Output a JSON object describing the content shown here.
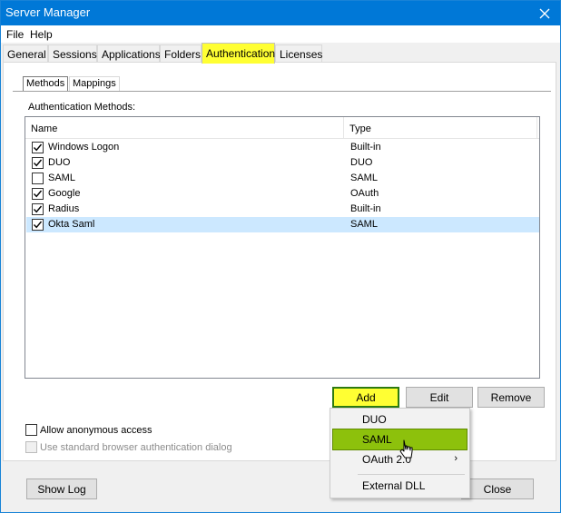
{
  "window": {
    "title": "Server Manager"
  },
  "menu": {
    "file": "File",
    "help": "Help"
  },
  "tabs": [
    "General",
    "Sessions",
    "Applications",
    "Folders",
    "Authentication",
    "Licenses"
  ],
  "active_tab": "Authentication",
  "subtabs": [
    "Methods",
    "Mappings"
  ],
  "active_subtab": "Methods",
  "auth_methods": {
    "caption": "Authentication Methods:",
    "columns": {
      "name": "Name",
      "type": "Type"
    },
    "rows": [
      {
        "name": "Windows Logon",
        "type": "Built-in",
        "checked": true
      },
      {
        "name": "DUO",
        "type": "DUO",
        "checked": true
      },
      {
        "name": "SAML",
        "type": "SAML",
        "checked": false
      },
      {
        "name": "Google",
        "type": "OAuth",
        "checked": true
      },
      {
        "name": "Radius",
        "type": "Built-in",
        "checked": true
      },
      {
        "name": "Okta Saml",
        "type": "SAML",
        "checked": true,
        "selected": true
      }
    ]
  },
  "buttons": {
    "add": "Add",
    "edit": "Edit",
    "remove": "Remove",
    "show_log": "Show Log",
    "close": "Close"
  },
  "options": {
    "anonymous": "Allow anonymous access",
    "browser_dialog": "Use standard browser authentication dialog"
  },
  "add_menu": {
    "items": [
      {
        "label": "DUO",
        "submenu": false
      },
      {
        "label": "SAML",
        "submenu": false,
        "hot": true
      },
      {
        "label": "OAuth 2.0",
        "submenu": true
      },
      {
        "label": "External DLL",
        "submenu": false
      }
    ],
    "submenu_arrow": "›"
  },
  "colors": {
    "titlebar": "#0078d7",
    "highlight": "#ffff33",
    "menu_hot": "#8dc10c",
    "selected_row": "#cce8ff"
  }
}
